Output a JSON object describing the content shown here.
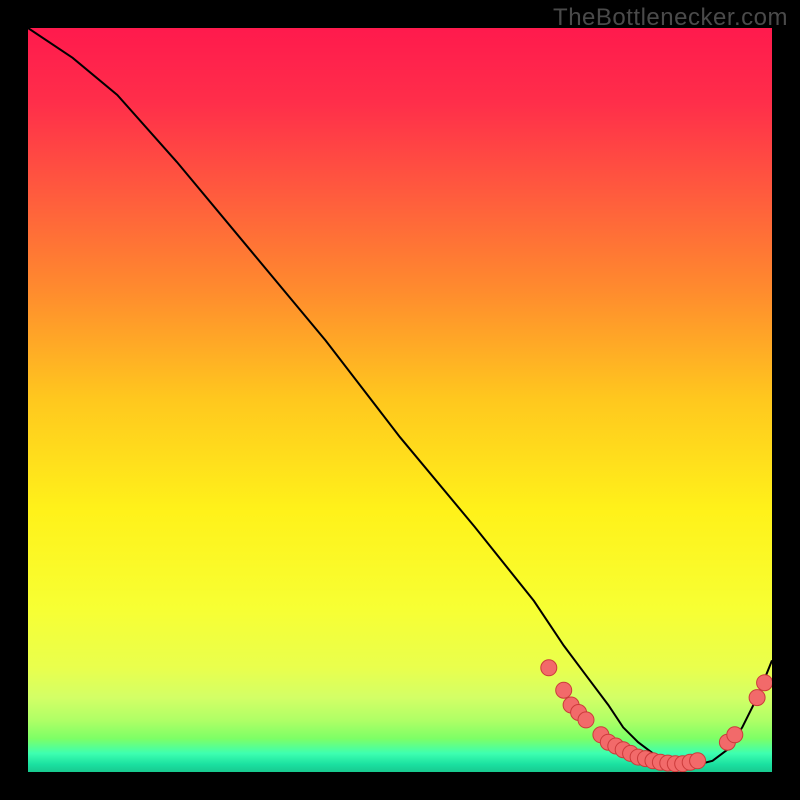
{
  "brand": "TheBottlenecker.com",
  "colors": {
    "bg": "#000000",
    "curve": "#000000",
    "marker_fill": "#f26a6a",
    "marker_stroke": "#cc3b3b",
    "brand_text": "#4a4a4a"
  },
  "chart_data": {
    "type": "line",
    "title": "",
    "xlabel": "",
    "ylabel": "",
    "xlim": [
      0,
      100
    ],
    "ylim": [
      0,
      100
    ],
    "series": [
      {
        "name": "bottleneck-curve",
        "x": [
          0,
          6,
          12,
          20,
          30,
          40,
          50,
          60,
          68,
          72,
          75,
          78,
          80,
          82,
          84,
          86,
          88,
          90,
          92,
          94,
          96,
          98,
          100
        ],
        "y": [
          100,
          96,
          91,
          82,
          70,
          58,
          45,
          33,
          23,
          17,
          13,
          9,
          6,
          4,
          2.5,
          1.5,
          1,
          1,
          1.5,
          3,
          6,
          10,
          15
        ]
      }
    ],
    "markers": [
      {
        "x": 70,
        "y": 14
      },
      {
        "x": 72,
        "y": 11
      },
      {
        "x": 73,
        "y": 9
      },
      {
        "x": 74,
        "y": 8
      },
      {
        "x": 75,
        "y": 7
      },
      {
        "x": 77,
        "y": 5
      },
      {
        "x": 78,
        "y": 4
      },
      {
        "x": 79,
        "y": 3.5
      },
      {
        "x": 80,
        "y": 3
      },
      {
        "x": 81,
        "y": 2.5
      },
      {
        "x": 82,
        "y": 2
      },
      {
        "x": 83,
        "y": 1.8
      },
      {
        "x": 84,
        "y": 1.5
      },
      {
        "x": 85,
        "y": 1.3
      },
      {
        "x": 86,
        "y": 1.2
      },
      {
        "x": 87,
        "y": 1.1
      },
      {
        "x": 88,
        "y": 1.1
      },
      {
        "x": 89,
        "y": 1.3
      },
      {
        "x": 90,
        "y": 1.5
      },
      {
        "x": 94,
        "y": 4
      },
      {
        "x": 95,
        "y": 5
      },
      {
        "x": 98,
        "y": 10
      },
      {
        "x": 99,
        "y": 12
      }
    ],
    "gradient_stops": [
      {
        "offset": 0.0,
        "color": "#ff1a4d"
      },
      {
        "offset": 0.1,
        "color": "#ff2e4a"
      },
      {
        "offset": 0.22,
        "color": "#ff5a3e"
      },
      {
        "offset": 0.35,
        "color": "#ff8a2e"
      },
      {
        "offset": 0.5,
        "color": "#ffc81e"
      },
      {
        "offset": 0.65,
        "color": "#fff21a"
      },
      {
        "offset": 0.78,
        "color": "#f7ff33"
      },
      {
        "offset": 0.86,
        "color": "#e9ff4d"
      },
      {
        "offset": 0.9,
        "color": "#d3ff66"
      },
      {
        "offset": 0.93,
        "color": "#b0ff66"
      },
      {
        "offset": 0.955,
        "color": "#7dff66"
      },
      {
        "offset": 0.975,
        "color": "#3dffb0"
      },
      {
        "offset": 0.99,
        "color": "#1ae0a0"
      },
      {
        "offset": 1.0,
        "color": "#18c98f"
      }
    ]
  }
}
